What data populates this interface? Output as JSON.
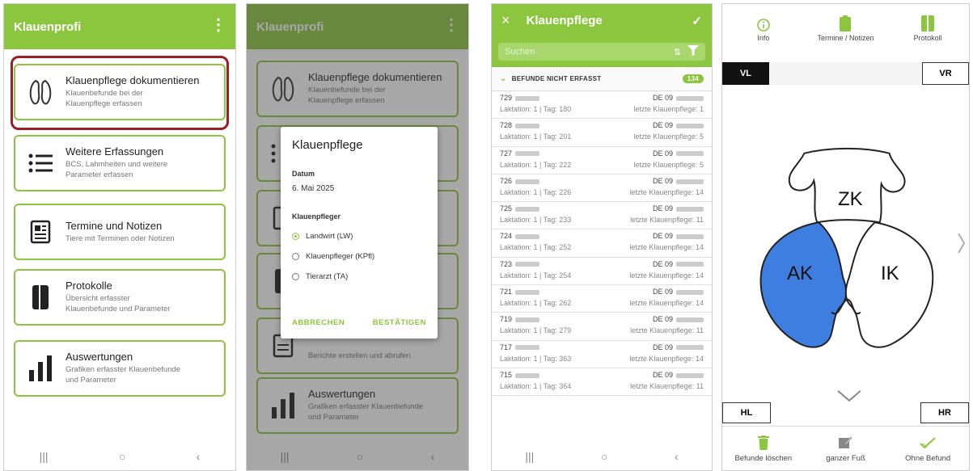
{
  "screen1": {
    "title": "Klauenprofi",
    "menu": [
      {
        "title": "Klauenpflege dokumentieren",
        "sub1": "Klauenbefunde bei der",
        "sub2": "Klauenpflege erfassen"
      },
      {
        "title": "Weitere Erfassungen",
        "sub1": "BCS, Lahmheiten und weitere",
        "sub2": "Parameter erfassen"
      },
      {
        "title": "Termine und Notizen",
        "sub1": "Tiere mit Terminen oder Notizen",
        "sub2": ""
      },
      {
        "title": "Protokolle",
        "sub1": "Übersicht erfasster",
        "sub2": "Klauenbefunde und Parameter"
      },
      {
        "title": "Auswertungen",
        "sub1": "Grafiken erfasster Klauenbefunde",
        "sub2": "und Parameter"
      }
    ],
    "nav": [
      "|||",
      "○",
      "‹"
    ]
  },
  "screen2": {
    "title": "Klauenprofi",
    "bg_card1_title": "Klauenpflege dokumentieren",
    "bg_card1_sub1": "Klauenbefunde bei der",
    "bg_card1_sub2": "Klauenpflege erfassen",
    "bg_card4_sub": "Berichte erstellen und abrufen",
    "bg_card5_title": "Auswertungen",
    "bg_card5_sub1": "Grafiken erfasster Klauenbefunde",
    "bg_card5_sub2": "und Parameter",
    "dialog": {
      "title": "Klauenpflege",
      "date_label": "Datum",
      "date_value": "6. Mai 2025",
      "person_label": "Klauenpfleger",
      "options": [
        "Landwirt (LW)",
        "Klauenpfleger (KPfl)",
        "Tierarzt (TA)"
      ],
      "selected": 0,
      "cancel": "ABBRECHEN",
      "confirm": "BESTÄTIGEN"
    },
    "nav": [
      "|||",
      "○",
      "‹"
    ]
  },
  "screen3": {
    "close": "×",
    "title": "Klauenpflege",
    "check": "✓",
    "search_placeholder": "Suchen",
    "section_label": "BEFUNDE NICHT ERFASST",
    "section_count": "134",
    "rows": [
      {
        "num": "729",
        "de": "DE 09",
        "lak": "Laktation: 1 | Tag: 180",
        "last": "letzte Klauenpflege: 1"
      },
      {
        "num": "728",
        "de": "DE 09",
        "lak": "Laktation: 1 | Tag: 201",
        "last": "letzte Klauenpflege: 5"
      },
      {
        "num": "727",
        "de": "DE 09",
        "lak": "Laktation: 1 | Tag: 222",
        "last": "letzte Klauenpflege: 5"
      },
      {
        "num": "726",
        "de": "DE 09",
        "lak": "Laktation: 1 | Tag: 226",
        "last": "letzte Klauenpflege: 14"
      },
      {
        "num": "725",
        "de": "DE 09",
        "lak": "Laktation: 1 | Tag: 233",
        "last": "letzte Klauenpflege: 11"
      },
      {
        "num": "724",
        "de": "DE 09",
        "lak": "Laktation: 1 | Tag: 252",
        "last": "letzte Klauenpflege: 14"
      },
      {
        "num": "723",
        "de": "DE 09",
        "lak": "Laktation: 1 | Tag: 254",
        "last": "letzte Klauenpflege: 14"
      },
      {
        "num": "721",
        "de": "DE 09",
        "lak": "Laktation: 1 | Tag: 262",
        "last": "letzte Klauenpflege: 14"
      },
      {
        "num": "719",
        "de": "DE 09",
        "lak": "Laktation: 1 | Tag: 279",
        "last": "letzte Klauenpflege: 11"
      },
      {
        "num": "717",
        "de": "DE 09",
        "lak": "Laktation: 1 | Tag: 363",
        "last": "letzte Klauenpflege: 14"
      },
      {
        "num": "715",
        "de": "DE 09",
        "lak": "Laktation: 1 | Tag: 364",
        "last": "letzte Klauenpflege: 11"
      }
    ],
    "nav": [
      "|||",
      "○",
      "‹"
    ]
  },
  "screen4": {
    "tabs": [
      "Info",
      "Termine / Notizen",
      "Protokoll"
    ],
    "corners": {
      "vl": "VL",
      "vr": "VR",
      "hl": "HL",
      "hr": "HR"
    },
    "zones": {
      "zk": "ZK",
      "ak": "AK",
      "ik": "IK"
    },
    "highlight_color": "#3d7ee0",
    "footer": [
      "Befunde löschen",
      "ganzer Fuß",
      "Ohne Befund"
    ]
  },
  "colors": {
    "accent": "#8cc63e",
    "highlight_border": "#9b1d25"
  }
}
